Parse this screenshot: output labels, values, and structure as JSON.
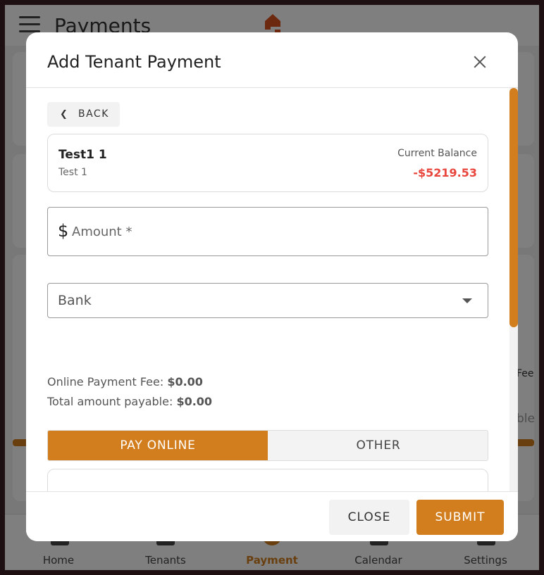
{
  "app": {
    "title": "Payments",
    "side_texts": [
      "Fee",
      "ble"
    ],
    "nav": [
      {
        "label": "Home",
        "icon": "home-icon",
        "active": false
      },
      {
        "label": "Tenants",
        "icon": "tenants-icon",
        "active": false
      },
      {
        "label": "Payment",
        "icon": "payment-icon",
        "active": true
      },
      {
        "label": "Calendar",
        "icon": "calendar-icon",
        "active": false
      },
      {
        "label": "Settings",
        "icon": "settings-icon",
        "active": false
      }
    ]
  },
  "dialog": {
    "title": "Add Tenant Payment",
    "back_label": "BACK",
    "tenant": {
      "name": "Test1 1",
      "subtitle": "Test 1",
      "balance_label": "Current Balance",
      "balance_value": "-$5219.53"
    },
    "amount": {
      "prefix": "$",
      "placeholder": "Amount *"
    },
    "bank": {
      "label": "Bank"
    },
    "fees": {
      "online_fee_label": "Online Payment Fee:",
      "online_fee_value": "$0.00",
      "total_label": "Total amount payable:",
      "total_value": "$0.00"
    },
    "toggle": {
      "pay_online": "PAY ONLINE",
      "other": "OTHER",
      "selected": "pay_online"
    },
    "footer": {
      "close_label": "CLOSE",
      "submit_label": "SUBMIT"
    }
  },
  "colors": {
    "accent": "#d27e1e",
    "negative": "#e8453c"
  }
}
